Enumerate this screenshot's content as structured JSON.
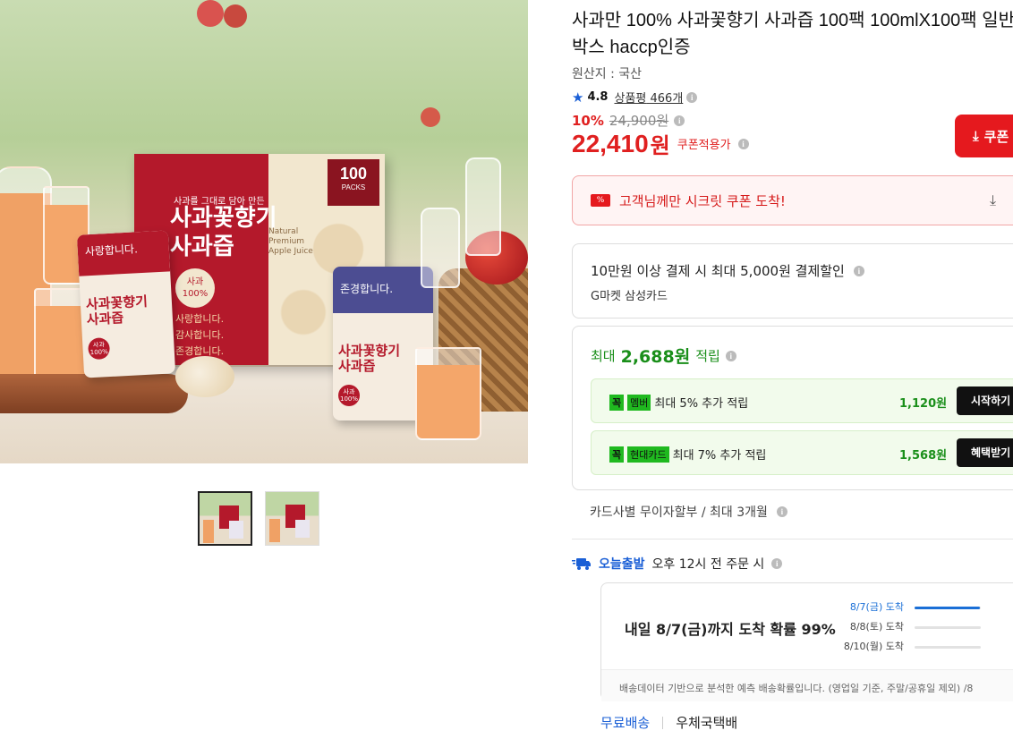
{
  "product": {
    "title": "사과만 100% 사과꽃향기 사과즙 100팩 100mlX100팩 일반박스 haccp인증",
    "origin": "원산지 : 국산",
    "rating": "4.8",
    "review_label": "상품평",
    "review_count": "466개",
    "discount_pct": "10%",
    "original_price": "24,900원",
    "price": "22,410",
    "price_unit": "원",
    "coupon_note": "쿠폰적용가"
  },
  "image": {
    "box_sub": "사과를 그대로 담아 만든",
    "box_title_1": "사과꽃향기",
    "box_title_2": "사과즙",
    "box_eng": "Natural Premium Apple Juice",
    "box_count": "100",
    "box_packs": "PACKS",
    "box_badge_1": "사과",
    "box_badge_2": "100%",
    "bless_1": "사랑합니다.",
    "bless_2": "감사합니다.",
    "bless_3": "존경합니다.",
    "pouch1_head": "사랑합니다.",
    "pouch1_title_1": "사과꽃향기",
    "pouch1_title_2": "사과즙",
    "pouch1_badge": "사과 100%",
    "pouch2_head": "존경합니다.",
    "pouch2_title_1": "사과꽃향기",
    "pouch2_title_2": "사과즙",
    "pouch2_badge": "사과 100%"
  },
  "coupon_button": "쿠폰",
  "secret_coupon": {
    "badge": "%",
    "text": "고객님께만 시크릿 쿠폰 도착!"
  },
  "card_discount": {
    "line1": "10만원 이상 결제 시 최대 5,000원 결제할인",
    "line2": "G마켓 삼성카드"
  },
  "points": {
    "prefix": "최대",
    "amount": "2,688원",
    "suffix": "적립",
    "rows": [
      {
        "tag1": "꼭",
        "tag2": "멤버",
        "text": "최대 5% 추가 적립",
        "amount": "1,120원",
        "button": "시작하기"
      },
      {
        "tag1": "꼭",
        "tag2": "현대카드",
        "text": "최대 7% 추가 적립",
        "amount": "1,568원",
        "button": "혜택받기"
      }
    ]
  },
  "installment": "카드사별 무이자할부 / 최대 3개월",
  "shipping": {
    "brand": "오늘출발",
    "cutoff": "오후 12시 전 주문 시",
    "headline": "내일 8/7(금)까지 도착 확률 99%",
    "rows": [
      {
        "label": "8/7(금) 도착",
        "value": 0.99
      },
      {
        "label": "8/8(토) 도착",
        "value": 0.0
      },
      {
        "label": "8/10(월) 도착",
        "value": 0.0
      }
    ],
    "footnote": "배송데이터 기반으로 분석한 예측 배송확률입니다. (영업일 기준, 주말/공휴일 제외) /8",
    "free": "무료배송",
    "carrier": "우체국택배"
  },
  "colors": {
    "price_red": "#e02020",
    "point_green": "#1a8f1a",
    "link_blue": "#1a5fd6"
  }
}
